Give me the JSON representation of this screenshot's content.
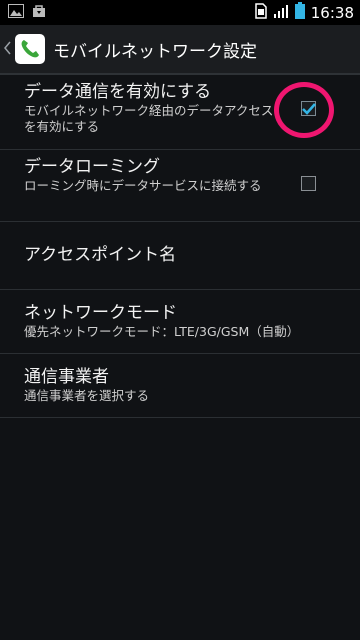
{
  "status_bar": {
    "time": "16:38",
    "icons": [
      "picture-icon",
      "bag-icon",
      "sim-icon",
      "signal-icon",
      "battery-icon"
    ]
  },
  "action_bar": {
    "title": "モバイルネットワーク設定",
    "app_icon": "phone-icon"
  },
  "settings": [
    {
      "title": "データ通信を有効にする",
      "subtitle": "モバイルネットワーク経由のデータアクセスを有効にする",
      "has_checkbox": true,
      "checked": true
    },
    {
      "title": "データローミング",
      "subtitle": "ローミング時にデータサービスに接続する",
      "has_checkbox": true,
      "checked": false
    },
    {
      "title": "アクセスポイント名",
      "subtitle": "",
      "has_checkbox": false
    },
    {
      "title": "ネットワークモード",
      "subtitle": "優先ネットワークモード：LTE/3G/GSM（自動）",
      "has_checkbox": false
    },
    {
      "title": "通信事業者",
      "subtitle": "通信事業者を選択する",
      "has_checkbox": false
    }
  ],
  "colors": {
    "accent": "#33b5e5",
    "highlight_circle": "#ef1670",
    "background": "#101215"
  }
}
